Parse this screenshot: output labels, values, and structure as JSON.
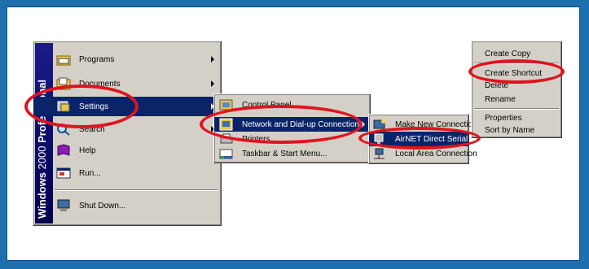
{
  "start_menu": {
    "banner_brand": "Windows",
    "banner_version": "2000",
    "banner_edition": "Professional",
    "items": [
      {
        "label": "Programs",
        "icon": "programs-folder-icon",
        "submenu": true
      },
      {
        "label": "Documents",
        "icon": "documents-folder-icon",
        "submenu": true
      },
      {
        "label": "Settings",
        "icon": "settings-icon",
        "submenu": true,
        "highlighted": true
      },
      {
        "label": "Search",
        "icon": "search-icon",
        "submenu": true
      },
      {
        "label": "Help",
        "icon": "help-icon",
        "submenu": false
      },
      {
        "label": "Run...",
        "icon": "run-icon",
        "submenu": false
      },
      {
        "label": "Shut Down...",
        "icon": "shutdown-icon",
        "submenu": false
      }
    ]
  },
  "settings_menu": {
    "items": [
      {
        "label": "Control Panel",
        "icon": "control-panel-icon"
      },
      {
        "label": "Network and Dial-up Connections",
        "icon": "network-connections-icon",
        "submenu": true,
        "highlighted": true
      },
      {
        "label": "Printers",
        "icon": "printers-icon"
      },
      {
        "label": "Taskbar & Start Menu...",
        "icon": "taskbar-icon"
      }
    ]
  },
  "network_menu": {
    "items": [
      {
        "label": "Make New Connection",
        "icon": "make-connection-icon"
      },
      {
        "label": "AirNET Direct Serial",
        "icon": "serial-connection-icon",
        "highlighted": true
      },
      {
        "label": "Local Area Connection",
        "icon": "lan-icon"
      }
    ]
  },
  "context_menu": {
    "items": [
      {
        "label": "Create Copy"
      },
      {
        "label": "Create Shortcut"
      },
      {
        "label": "Delete"
      },
      {
        "label": "Rename"
      },
      {
        "label": "Properties"
      },
      {
        "label": "Sort by Name"
      }
    ]
  },
  "colors": {
    "highlight": "#0a246a",
    "menu_face": "#d4d0c8",
    "annotation_ring": "#e0141e",
    "page_border": "#1e6fae"
  }
}
